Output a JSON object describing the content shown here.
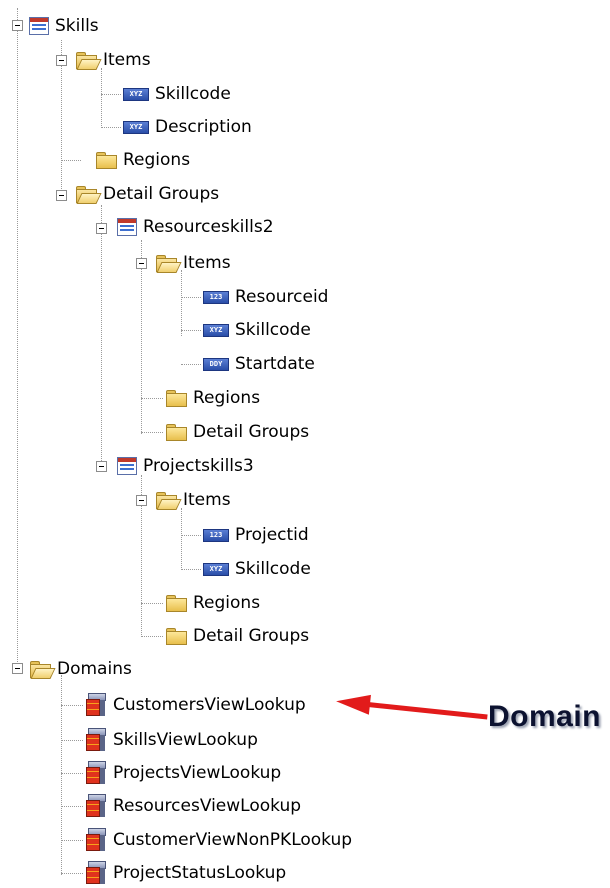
{
  "tree": {
    "skills": {
      "label": "Skills",
      "icon": "table-icon",
      "items": {
        "label": "Items",
        "children": [
          {
            "label": "Skillcode",
            "type": "XYZ"
          },
          {
            "label": "Description",
            "type": "XYZ"
          }
        ]
      },
      "regions": {
        "label": "Regions"
      },
      "detail_groups": {
        "label": "Detail Groups",
        "resourceskills2": {
          "label": "Resourceskills2",
          "items": {
            "label": "Items",
            "children": [
              {
                "label": "Resourceid",
                "type": "123"
              },
              {
                "label": "Skillcode",
                "type": "XYZ"
              },
              {
                "label": "Startdate",
                "type": "DDY"
              }
            ]
          },
          "regions": {
            "label": "Regions"
          },
          "detail_groups": {
            "label": "Detail Groups"
          }
        },
        "projectskills3": {
          "label": "Projectskills3",
          "items": {
            "label": "Items",
            "children": [
              {
                "label": "Projectid",
                "type": "123"
              },
              {
                "label": "Skillcode",
                "type": "XYZ"
              }
            ]
          },
          "regions": {
            "label": "Regions"
          },
          "detail_groups": {
            "label": "Detail Groups"
          }
        }
      }
    },
    "domains": {
      "label": "Domains",
      "children": [
        {
          "label": "CustomersViewLookup"
        },
        {
          "label": "SkillsViewLookup"
        },
        {
          "label": "ProjectsViewLookup"
        },
        {
          "label": "ResourcesViewLookup"
        },
        {
          "label": "CustomerViewNonPKLookup"
        },
        {
          "label": "ProjectStatusLookup"
        }
      ]
    }
  },
  "callout": {
    "text": "Domain",
    "color": "#e21b1b"
  }
}
